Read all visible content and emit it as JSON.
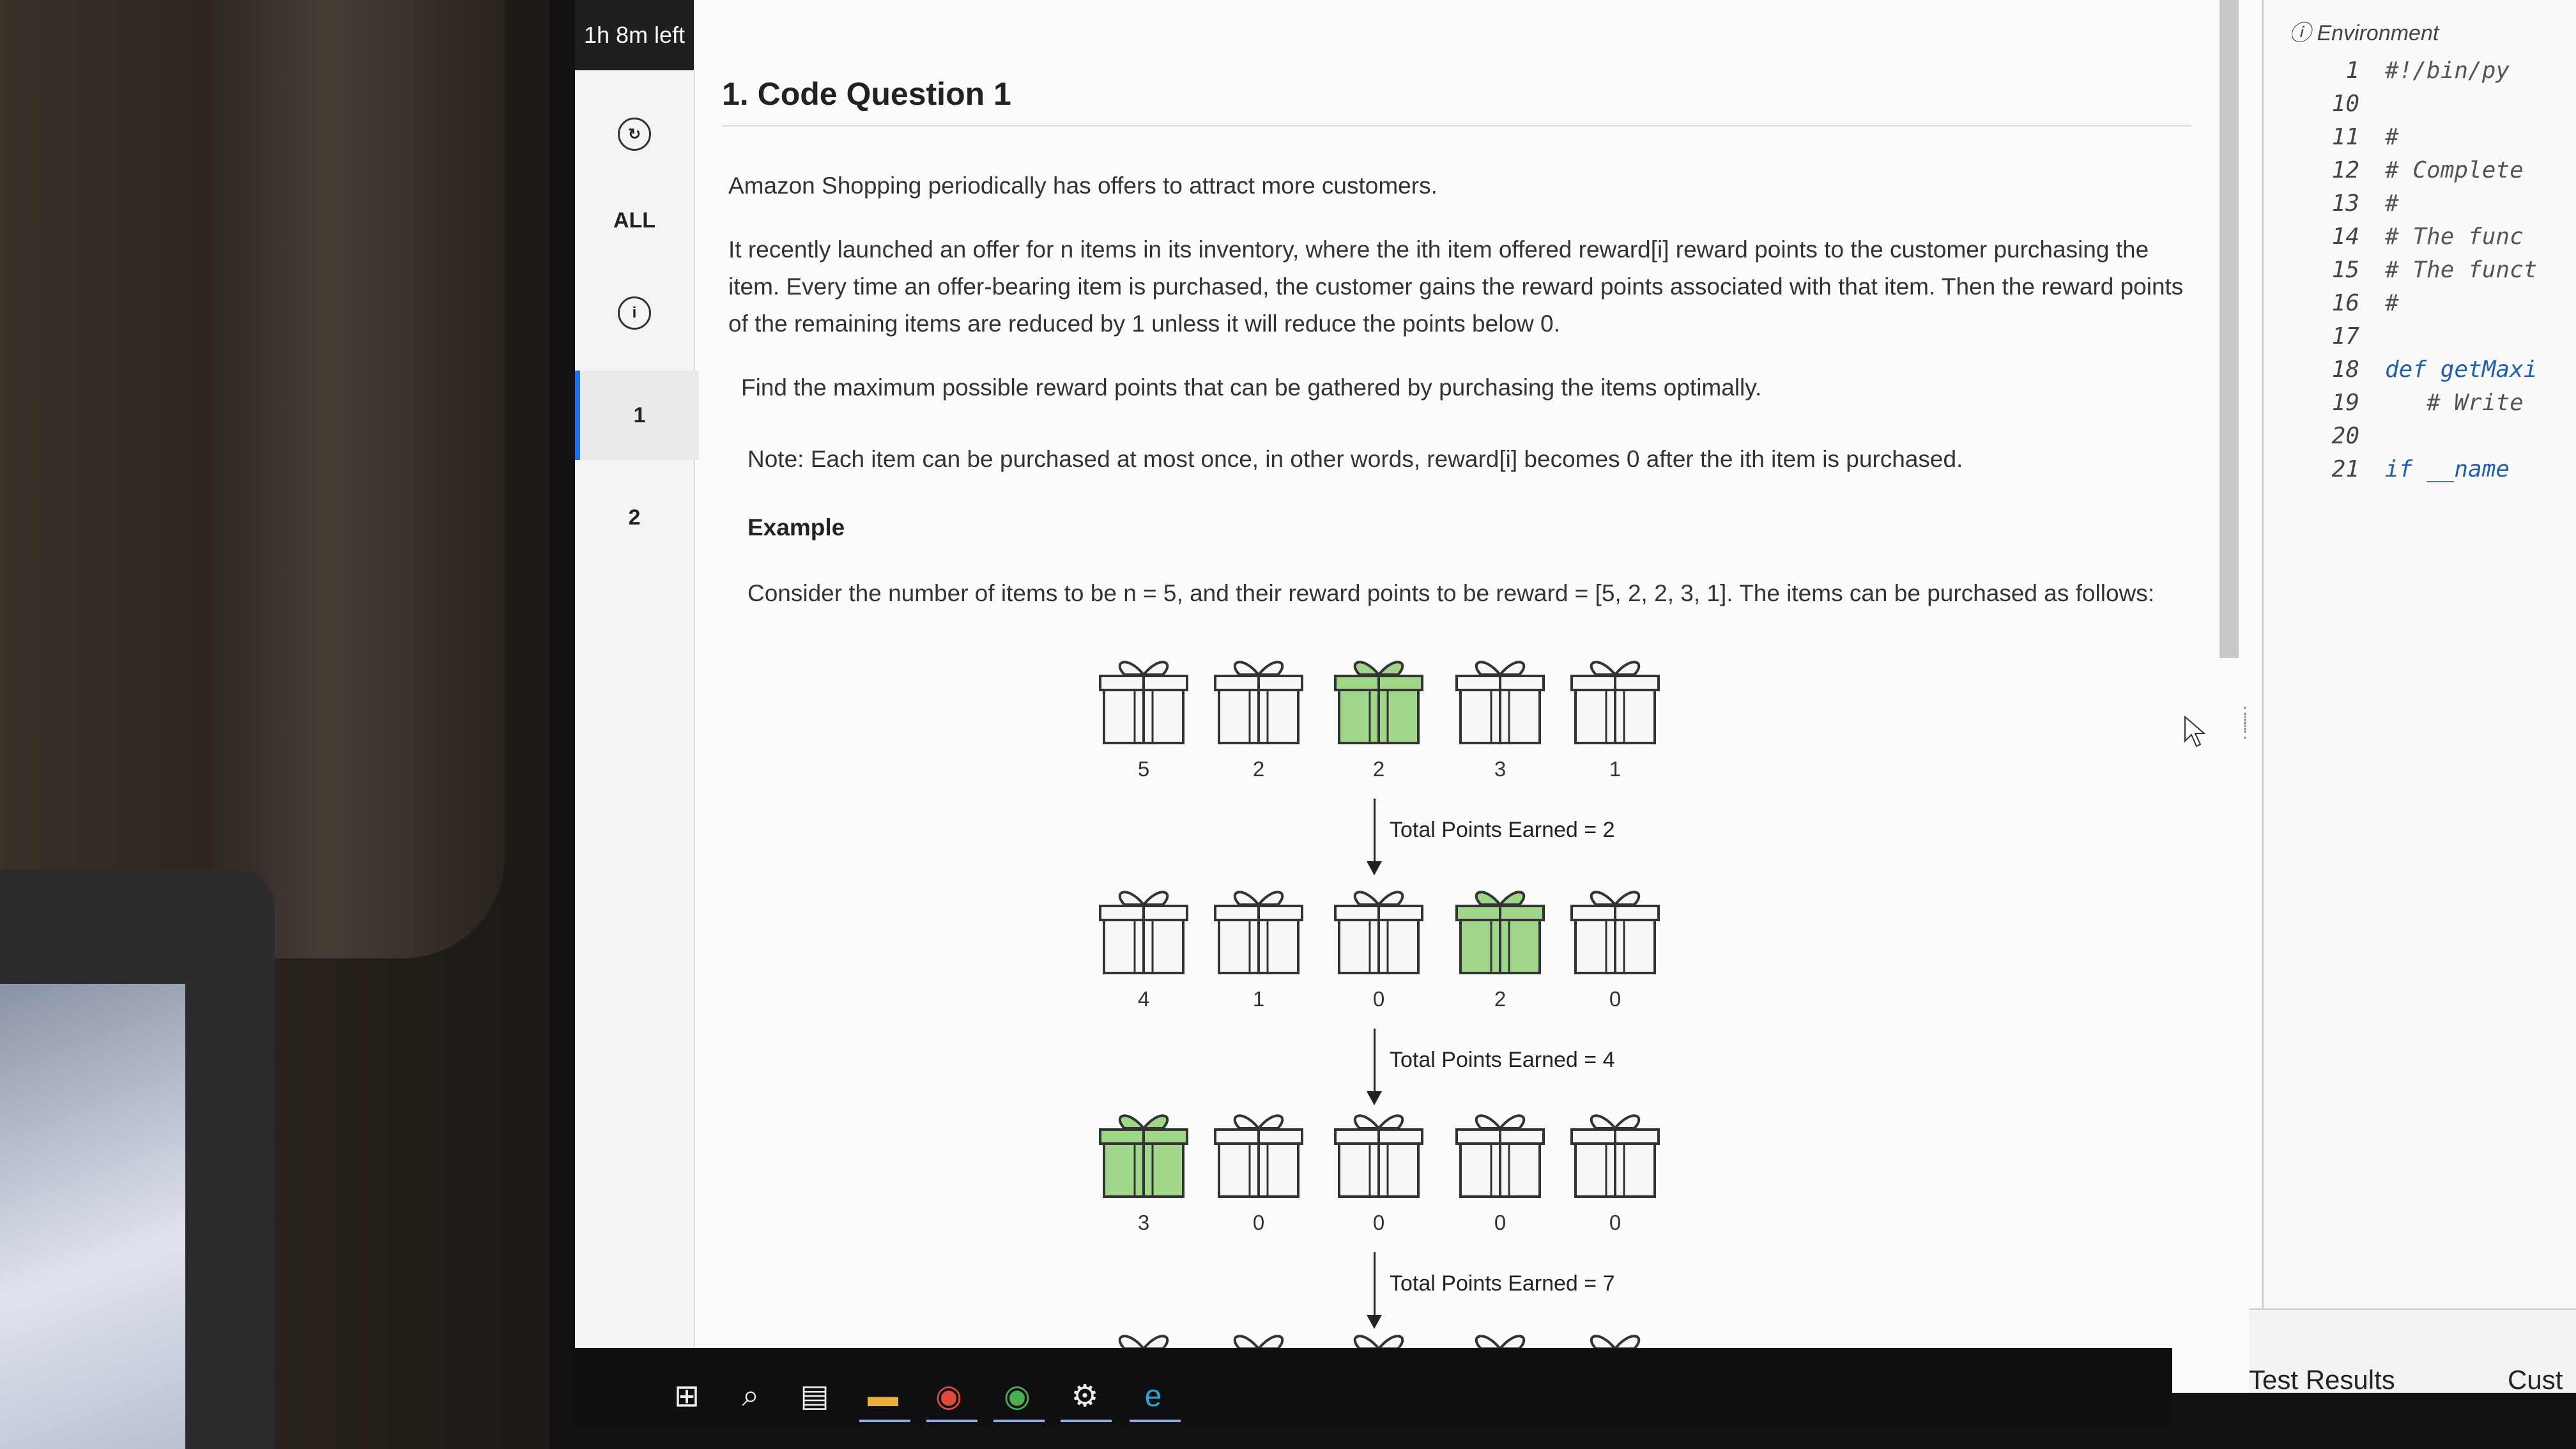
{
  "timer": {
    "label": "1h 8m left"
  },
  "nav": {
    "all_label": "ALL",
    "questions": [
      "1",
      "2"
    ]
  },
  "question": {
    "title": "1. Code Question 1",
    "intro": "Amazon Shopping periodically has offers to attract more customers.",
    "offer": "It recently launched an offer for n items in its inventory, where the ith item offered reward[i] reward points to the customer purchasing the item. Every time an offer-bearing item is purchased, the customer gains the reward points associated with that item. Then the reward points of the remaining items are reduced by 1 unless it will reduce the points below 0.",
    "task": "Find the maximum possible reward points that can be gathered by purchasing the items optimally.",
    "note": "Note: Each item can be purchased at most once, in other words, reward[i] becomes 0 after the ith item is purchased.",
    "example_heading": "Example",
    "example_text": "Consider the number of items to be n = 5, and their reward points to be reward = [5, 2, 2, 3, 1]. The items can be purchased as follows:"
  },
  "example_rows": [
    {
      "values": [
        "5",
        "2",
        "2",
        "3",
        "1"
      ],
      "highlighted": 2,
      "earned": "Total Points Earned = 2"
    },
    {
      "values": [
        "4",
        "1",
        "0",
        "2",
        "0"
      ],
      "highlighted": 3,
      "earned": "Total Points Earned = 4"
    },
    {
      "values": [
        "3",
        "0",
        "0",
        "0",
        "0"
      ],
      "highlighted": 0,
      "earned": "Total Points Earned = 7"
    }
  ],
  "editor": {
    "environment_label": "Environment",
    "lines": [
      {
        "num": "1",
        "text": "#!/bin/py",
        "kw": false
      },
      {
        "num": "10",
        "text": "",
        "kw": false
      },
      {
        "num": "11",
        "text": "#",
        "kw": false
      },
      {
        "num": "12",
        "text": "# Complete",
        "kw": false
      },
      {
        "num": "13",
        "text": "#",
        "kw": false
      },
      {
        "num": "14",
        "text": "# The func",
        "kw": false
      },
      {
        "num": "15",
        "text": "# The funct",
        "kw": false
      },
      {
        "num": "16",
        "text": "#",
        "kw": false
      },
      {
        "num": "17",
        "text": "",
        "kw": false
      },
      {
        "num": "18",
        "text": "def getMaxi",
        "kw": true
      },
      {
        "num": "19",
        "text": "   # Write",
        "kw": false
      },
      {
        "num": "20",
        "text": "",
        "kw": false
      },
      {
        "num": "21",
        "text": "if __name",
        "kw": true
      }
    ]
  },
  "results": {
    "test_results": "Test Results",
    "custom": "Cust"
  },
  "colors": {
    "highlight_gift": "#9fd68a",
    "accent": "#1f6feb",
    "taskbar": "#0f0f12"
  }
}
